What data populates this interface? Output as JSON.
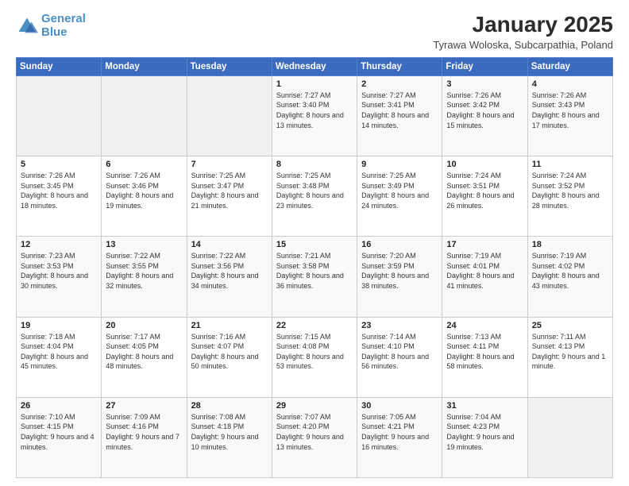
{
  "logo": {
    "text1": "General",
    "text2": "Blue"
  },
  "title": "January 2025",
  "subtitle": "Tyrawa Woloska, Subcarpathia, Poland",
  "weekdays": [
    "Sunday",
    "Monday",
    "Tuesday",
    "Wednesday",
    "Thursday",
    "Friday",
    "Saturday"
  ],
  "weeks": [
    [
      {
        "day": "",
        "sunrise": "",
        "sunset": "",
        "daylight": ""
      },
      {
        "day": "",
        "sunrise": "",
        "sunset": "",
        "daylight": ""
      },
      {
        "day": "",
        "sunrise": "",
        "sunset": "",
        "daylight": ""
      },
      {
        "day": "1",
        "sunrise": "Sunrise: 7:27 AM",
        "sunset": "Sunset: 3:40 PM",
        "daylight": "Daylight: 8 hours and 13 minutes."
      },
      {
        "day": "2",
        "sunrise": "Sunrise: 7:27 AM",
        "sunset": "Sunset: 3:41 PM",
        "daylight": "Daylight: 8 hours and 14 minutes."
      },
      {
        "day": "3",
        "sunrise": "Sunrise: 7:26 AM",
        "sunset": "Sunset: 3:42 PM",
        "daylight": "Daylight: 8 hours and 15 minutes."
      },
      {
        "day": "4",
        "sunrise": "Sunrise: 7:26 AM",
        "sunset": "Sunset: 3:43 PM",
        "daylight": "Daylight: 8 hours and 17 minutes."
      }
    ],
    [
      {
        "day": "5",
        "sunrise": "Sunrise: 7:26 AM",
        "sunset": "Sunset: 3:45 PM",
        "daylight": "Daylight: 8 hours and 18 minutes."
      },
      {
        "day": "6",
        "sunrise": "Sunrise: 7:26 AM",
        "sunset": "Sunset: 3:46 PM",
        "daylight": "Daylight: 8 hours and 19 minutes."
      },
      {
        "day": "7",
        "sunrise": "Sunrise: 7:25 AM",
        "sunset": "Sunset: 3:47 PM",
        "daylight": "Daylight: 8 hours and 21 minutes."
      },
      {
        "day": "8",
        "sunrise": "Sunrise: 7:25 AM",
        "sunset": "Sunset: 3:48 PM",
        "daylight": "Daylight: 8 hours and 23 minutes."
      },
      {
        "day": "9",
        "sunrise": "Sunrise: 7:25 AM",
        "sunset": "Sunset: 3:49 PM",
        "daylight": "Daylight: 8 hours and 24 minutes."
      },
      {
        "day": "10",
        "sunrise": "Sunrise: 7:24 AM",
        "sunset": "Sunset: 3:51 PM",
        "daylight": "Daylight: 8 hours and 26 minutes."
      },
      {
        "day": "11",
        "sunrise": "Sunrise: 7:24 AM",
        "sunset": "Sunset: 3:52 PM",
        "daylight": "Daylight: 8 hours and 28 minutes."
      }
    ],
    [
      {
        "day": "12",
        "sunrise": "Sunrise: 7:23 AM",
        "sunset": "Sunset: 3:53 PM",
        "daylight": "Daylight: 8 hours and 30 minutes."
      },
      {
        "day": "13",
        "sunrise": "Sunrise: 7:22 AM",
        "sunset": "Sunset: 3:55 PM",
        "daylight": "Daylight: 8 hours and 32 minutes."
      },
      {
        "day": "14",
        "sunrise": "Sunrise: 7:22 AM",
        "sunset": "Sunset: 3:56 PM",
        "daylight": "Daylight: 8 hours and 34 minutes."
      },
      {
        "day": "15",
        "sunrise": "Sunrise: 7:21 AM",
        "sunset": "Sunset: 3:58 PM",
        "daylight": "Daylight: 8 hours and 36 minutes."
      },
      {
        "day": "16",
        "sunrise": "Sunrise: 7:20 AM",
        "sunset": "Sunset: 3:59 PM",
        "daylight": "Daylight: 8 hours and 38 minutes."
      },
      {
        "day": "17",
        "sunrise": "Sunrise: 7:19 AM",
        "sunset": "Sunset: 4:01 PM",
        "daylight": "Daylight: 8 hours and 41 minutes."
      },
      {
        "day": "18",
        "sunrise": "Sunrise: 7:19 AM",
        "sunset": "Sunset: 4:02 PM",
        "daylight": "Daylight: 8 hours and 43 minutes."
      }
    ],
    [
      {
        "day": "19",
        "sunrise": "Sunrise: 7:18 AM",
        "sunset": "Sunset: 4:04 PM",
        "daylight": "Daylight: 8 hours and 45 minutes."
      },
      {
        "day": "20",
        "sunrise": "Sunrise: 7:17 AM",
        "sunset": "Sunset: 4:05 PM",
        "daylight": "Daylight: 8 hours and 48 minutes."
      },
      {
        "day": "21",
        "sunrise": "Sunrise: 7:16 AM",
        "sunset": "Sunset: 4:07 PM",
        "daylight": "Daylight: 8 hours and 50 minutes."
      },
      {
        "day": "22",
        "sunrise": "Sunrise: 7:15 AM",
        "sunset": "Sunset: 4:08 PM",
        "daylight": "Daylight: 8 hours and 53 minutes."
      },
      {
        "day": "23",
        "sunrise": "Sunrise: 7:14 AM",
        "sunset": "Sunset: 4:10 PM",
        "daylight": "Daylight: 8 hours and 56 minutes."
      },
      {
        "day": "24",
        "sunrise": "Sunrise: 7:13 AM",
        "sunset": "Sunset: 4:11 PM",
        "daylight": "Daylight: 8 hours and 58 minutes."
      },
      {
        "day": "25",
        "sunrise": "Sunrise: 7:11 AM",
        "sunset": "Sunset: 4:13 PM",
        "daylight": "Daylight: 9 hours and 1 minute."
      }
    ],
    [
      {
        "day": "26",
        "sunrise": "Sunrise: 7:10 AM",
        "sunset": "Sunset: 4:15 PM",
        "daylight": "Daylight: 9 hours and 4 minutes."
      },
      {
        "day": "27",
        "sunrise": "Sunrise: 7:09 AM",
        "sunset": "Sunset: 4:16 PM",
        "daylight": "Daylight: 9 hours and 7 minutes."
      },
      {
        "day": "28",
        "sunrise": "Sunrise: 7:08 AM",
        "sunset": "Sunset: 4:18 PM",
        "daylight": "Daylight: 9 hours and 10 minutes."
      },
      {
        "day": "29",
        "sunrise": "Sunrise: 7:07 AM",
        "sunset": "Sunset: 4:20 PM",
        "daylight": "Daylight: 9 hours and 13 minutes."
      },
      {
        "day": "30",
        "sunrise": "Sunrise: 7:05 AM",
        "sunset": "Sunset: 4:21 PM",
        "daylight": "Daylight: 9 hours and 16 minutes."
      },
      {
        "day": "31",
        "sunrise": "Sunrise: 7:04 AM",
        "sunset": "Sunset: 4:23 PM",
        "daylight": "Daylight: 9 hours and 19 minutes."
      },
      {
        "day": "",
        "sunrise": "",
        "sunset": "",
        "daylight": ""
      }
    ]
  ]
}
